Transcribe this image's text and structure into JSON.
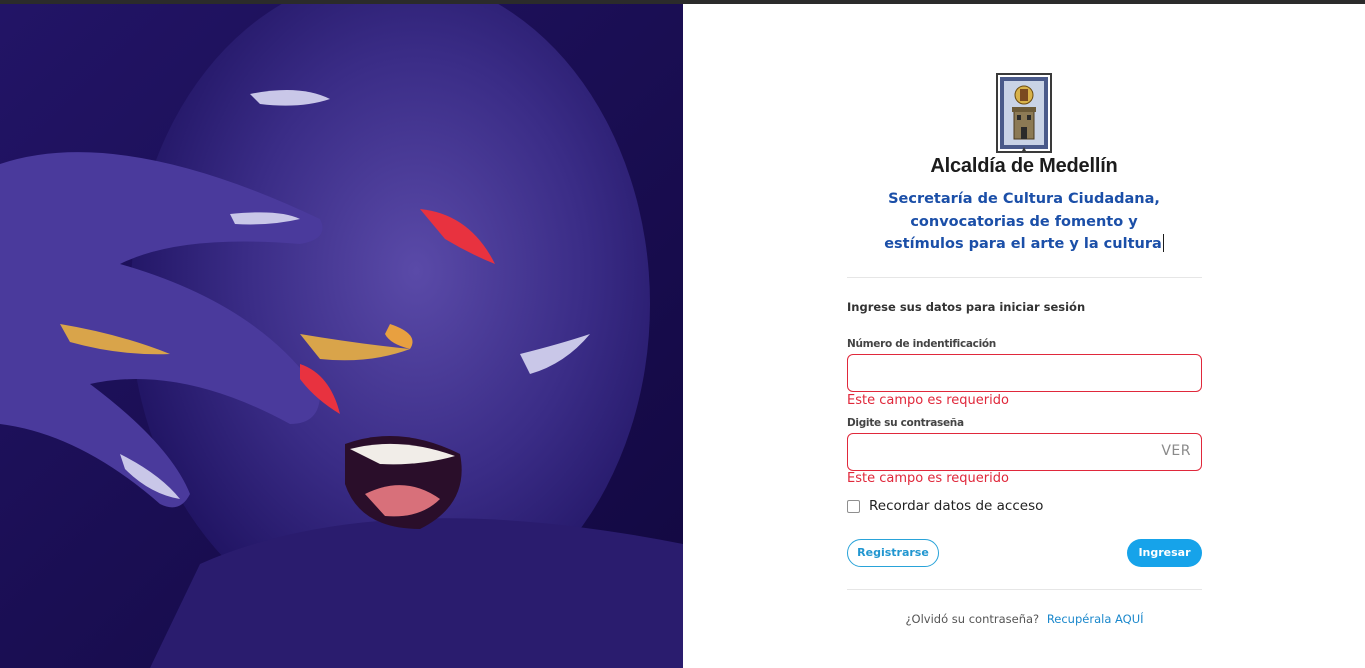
{
  "brand": {
    "name": "Alcaldía de Medellín",
    "subtitle_lines": [
      "Secretaría de Cultura Ciudadana,",
      "convocatorias de fomento y",
      "estímulos para el arte y la cultura"
    ],
    "logo_icon": "coat-of-arms-icon"
  },
  "login": {
    "intro": "Ingrese sus datos para iniciar sesión",
    "id_field": {
      "label": "Número de indentificación",
      "value": "",
      "placeholder": "",
      "error": "Este campo es requerido"
    },
    "password_field": {
      "label": "Digite su contraseña",
      "value": "",
      "placeholder": "",
      "toggle_label": "VER",
      "error": "Este campo es requerido"
    },
    "remember_label": "Recordar datos de acceso",
    "register_label": "Registrarse",
    "submit_label": "Ingresar",
    "forgot_text": "¿Olvidó su contraseña?",
    "recover_link": "Recupérala AQUÍ"
  },
  "colors": {
    "accent": "#16a3ea",
    "heading": "#1b4fa8",
    "error": "#e0283b",
    "hero_background": "#1b0f52"
  }
}
